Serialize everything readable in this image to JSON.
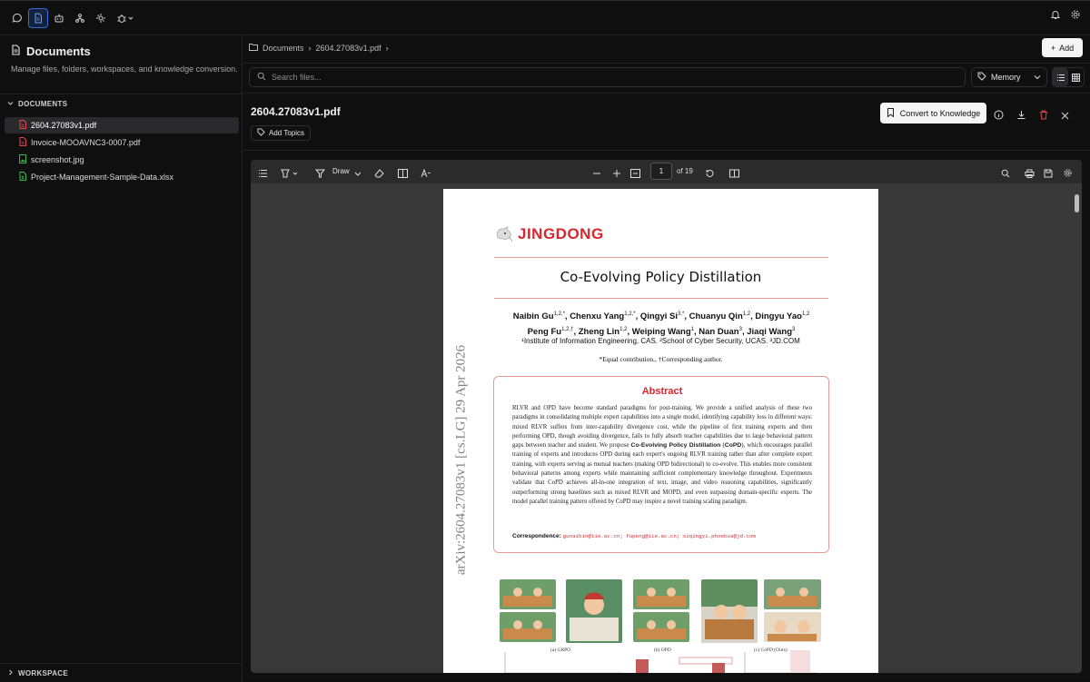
{
  "topbar": {
    "icons": [
      "chat-icon",
      "document-icon",
      "bot-icon",
      "hierarchy-icon",
      "settings-cog-icon",
      "bug-icon"
    ],
    "right_icons": [
      "bell-icon",
      "gear-icon"
    ]
  },
  "sidebar": {
    "title": "Documents",
    "subtitle": "Manage files, folders, workspaces, and knowledge conversion.",
    "section_label": "DOCUMENTS",
    "files": [
      {
        "name": "2604.27083v1.pdf",
        "type": "pdf"
      },
      {
        "name": "Invoice-MOOAVNC3-0007.pdf",
        "type": "pdf"
      },
      {
        "name": "screenshot.jpg",
        "type": "image"
      },
      {
        "name": "Project-Management-Sample-Data.xlsx",
        "type": "sheet"
      }
    ],
    "workspace_label": "WORKSPACE"
  },
  "header": {
    "breadcrumb_root": "Documents",
    "breadcrumb_file": "2604.27083v1.pdf",
    "add_label": "Add",
    "search_placeholder": "Search files...",
    "memory_label": "Memory"
  },
  "doc": {
    "title": "2604.27083v1.pdf",
    "add_topics_label": "Add Topics",
    "convert_label": "Convert to Knowledge"
  },
  "viewer": {
    "draw_label": "Draw",
    "page_current": "1",
    "page_total_label": "of 19"
  },
  "paper": {
    "logo": "JINGDONG",
    "title": "Co-Evolving Policy Distillation",
    "affiliations": "¹Institute of Information Engineering, CAS. ²School of Cyber Security, UCAS. ³JD.COM",
    "equal": "*Equal contribution., †Corresponding author.",
    "abstract_title": "Abstract",
    "abstract_pre": "RLVR and OPD have become standard paradigms for post-training. We provide a unified analysis of these two paradigms in consolidating multiple expert capabilities into a single model, identifying capability loss in different ways: mixed RLVR suffers from inter-capability divergence cost, while the pipeline of first training experts and then performing OPD, though avoiding divergence, fails to fully absorb teacher capabilities due to large behavioral pattern gaps between teacher and student. We propose",
    "abstract_method": "Co-Evolving Policy Distillation",
    "abstract_abbrev": "CoPD",
    "abstract_post": "), which encourages parallel training of experts and introduces OPD during each expert's ongoing RLVR training rather than after complete expert training, with experts serving as mutual teachers (making OPD bidirectional) to co-evolve. This enables more consistent behavioral patterns among experts while maintaining sufficient complementary knowledge throughout. Experiments validate that CoPD achieves all-in-one integration of text, image, and video reasoning capabilities, significantly outperforming strong baselines such as mixed RLVR and MOPD, and even surpassing domain-specific experts. The model parallel training pattern offered by CoPD may inspire a novel training scaling paradigm.",
    "corr_label": "Correspondence:",
    "corr_emails": "gunaibin@iie.ac.cn; fupeng@iie.ac.cn; siqingyi.phoebus@jd.com",
    "arxiv_stamp": "arXiv:2604.27083v1  [cs.LG]  29 Apr 2026",
    "fig_captions": [
      "(a) GRPO",
      "(b) OPD",
      "(c) CoPD (Ours)"
    ]
  }
}
